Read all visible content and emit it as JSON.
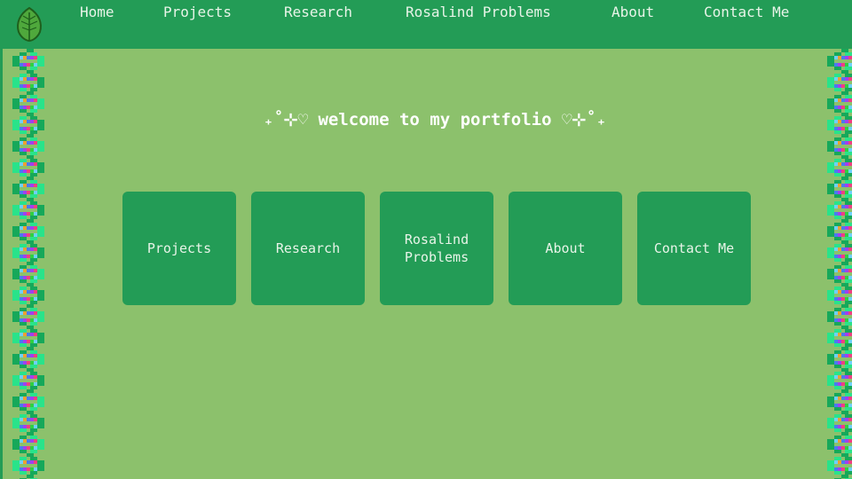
{
  "nav": {
    "logo_icon": "leaf-icon",
    "links": [
      "Home",
      "Projects",
      "Research",
      "Rosalind Problems",
      "About",
      "Contact Me"
    ]
  },
  "main": {
    "heading": "₊˚⊹♡ welcome to my portfolio ♡⊹˚₊",
    "cards": [
      "Projects",
      "Research",
      "Rosalind Problems",
      "About",
      "Contact Me"
    ]
  },
  "decor": {
    "border_icon": "dna-strand-icon"
  },
  "colors": {
    "background": "#8cc16c",
    "nav_background": "#239c56",
    "card_background": "#239c56",
    "text": "#e8f4e8",
    "dna_strand": "#29e38a",
    "dna_strand_dark": "#16a85a"
  }
}
